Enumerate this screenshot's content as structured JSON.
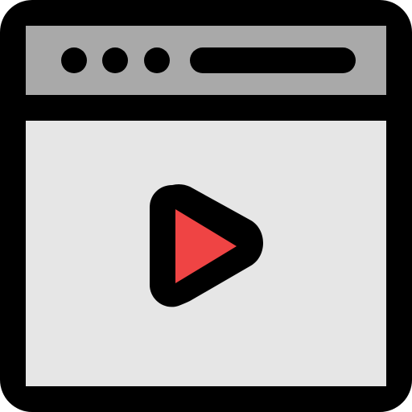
{
  "icon": {
    "name": "browser-video-icon",
    "parts": {
      "window": "browser-window-icon",
      "title_bar": "title-bar",
      "window_dots": [
        "window-dot-1",
        "window-dot-2",
        "window-dot-3"
      ],
      "address_bar": "address-bar",
      "content_area": "content-area",
      "play_button": "play-icon"
    }
  },
  "colors": {
    "outline": "#000000",
    "title_bar_fill": "#A9A9A9",
    "content_fill": "#E6E6E6",
    "play_fill": "#EF4444",
    "background": "#FFFFFF"
  }
}
